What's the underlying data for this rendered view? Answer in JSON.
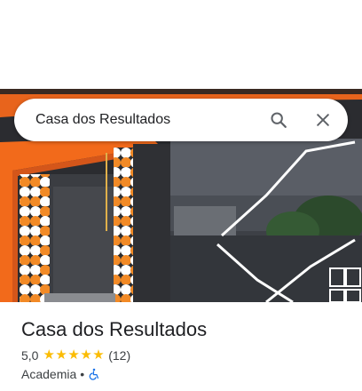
{
  "search": {
    "query": "Casa dos Resultados"
  },
  "place": {
    "name": "Casa dos Resultados",
    "rating": "5,0",
    "review_count": "(12)",
    "stars": 5,
    "category": "Academia",
    "separator": "•"
  },
  "icons": {
    "search": "search-icon",
    "close": "close-icon",
    "accessibility": "wheelchair-accessible-icon",
    "star": "star-icon"
  },
  "colors": {
    "star": "#fbbc04",
    "accessibility": "#1a73e8",
    "brand_orange": "#f26a1b"
  }
}
